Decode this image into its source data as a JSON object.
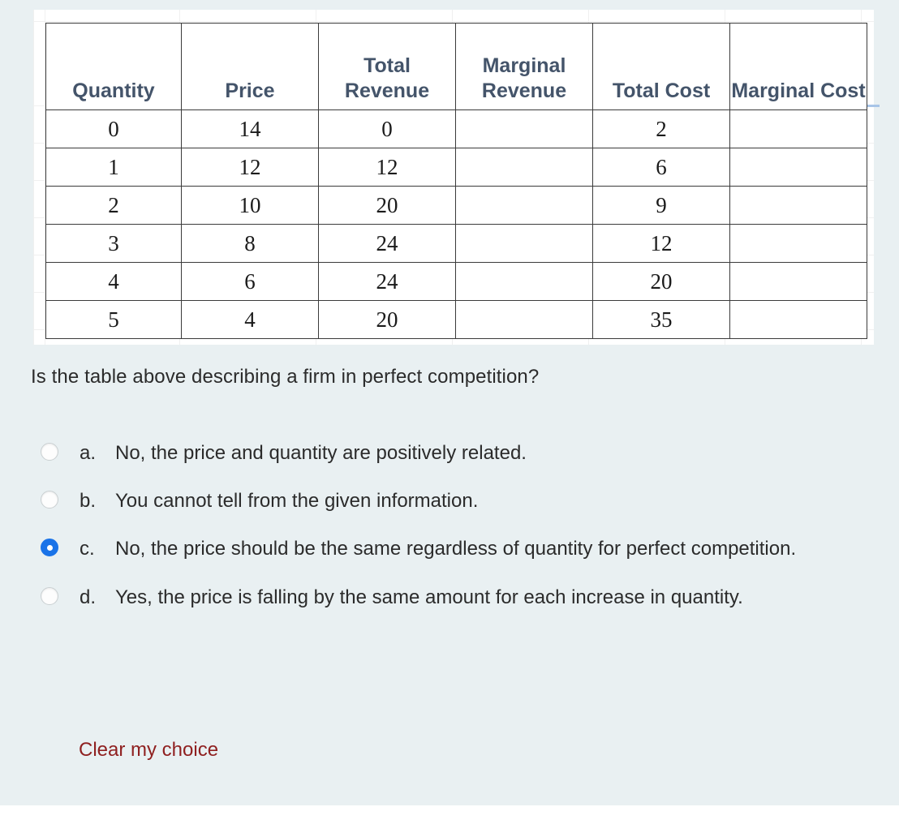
{
  "panel": {
    "background_color": "#e9f0f2"
  },
  "table": {
    "headers": [
      "Quantity",
      "Price",
      "Total Revenue",
      "Marginal Revenue",
      "Total Cost",
      "Marginal Cost"
    ],
    "header_color": "#44546a",
    "rows": [
      {
        "quantity": "0",
        "price": "14",
        "total_revenue": "0",
        "marginal_revenue": "",
        "total_cost": "2",
        "marginal_cost": ""
      },
      {
        "quantity": "1",
        "price": "12",
        "total_revenue": "12",
        "marginal_revenue": "",
        "total_cost": "6",
        "marginal_cost": ""
      },
      {
        "quantity": "2",
        "price": "10",
        "total_revenue": "20",
        "marginal_revenue": "",
        "total_cost": "9",
        "marginal_cost": ""
      },
      {
        "quantity": "3",
        "price": "8",
        "total_revenue": "24",
        "marginal_revenue": "",
        "total_cost": "12",
        "marginal_cost": ""
      },
      {
        "quantity": "4",
        "price": "6",
        "total_revenue": "24",
        "marginal_revenue": "",
        "total_cost": "20",
        "marginal_cost": ""
      },
      {
        "quantity": "5",
        "price": "4",
        "total_revenue": "20",
        "marginal_revenue": "",
        "total_cost": "35",
        "marginal_cost": ""
      }
    ]
  },
  "question": {
    "text": "Is the table above describing a firm in perfect competition?"
  },
  "options": [
    {
      "letter": "a.",
      "text": "No, the price and quantity are positively related.",
      "selected": false
    },
    {
      "letter": "b.",
      "text": "You cannot tell from the given information.",
      "selected": false
    },
    {
      "letter": "c.",
      "text": "No, the price should be the same regardless of quantity for perfect competition.",
      "selected": true
    },
    {
      "letter": "d.",
      "text": "Yes, the price is falling by the same amount for each increase in quantity.",
      "selected": false
    }
  ],
  "clear_choice": {
    "label": "Clear my choice",
    "color": "#8f2020"
  },
  "selected_accent_color": "#1a73e8"
}
